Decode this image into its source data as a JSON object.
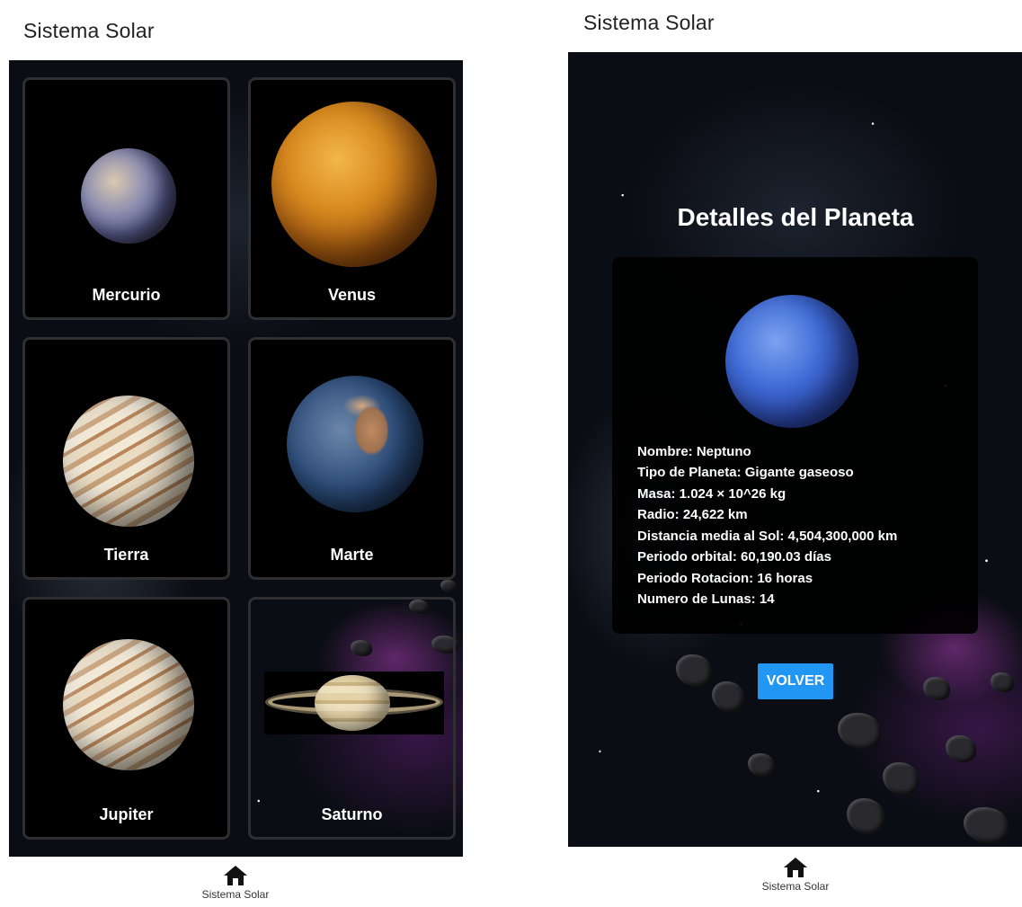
{
  "left_screen": {
    "app_title": "Sistema Solar",
    "planets": [
      {
        "name": "Mercurio"
      },
      {
        "name": "Venus"
      },
      {
        "name": "Tierra"
      },
      {
        "name": "Marte"
      },
      {
        "name": "Jupiter"
      },
      {
        "name": "Saturno"
      }
    ],
    "nav": {
      "label": "Sistema Solar",
      "icon": "home-icon"
    }
  },
  "right_screen": {
    "app_title": "Sistema Solar",
    "heading": "Detalles del Planeta",
    "details": {
      "name": "Nombre: Neptuno",
      "type": "Tipo de Planeta: Gigante gaseoso",
      "mass": "Masa: 1.024 × 10^26 kg",
      "radius": "Radio: 24,622 km",
      "distance": "Distancia media al Sol: 4,504,300,000 km",
      "orbit": "Periodo orbital: 60,190.03 días",
      "rotation": "Periodo Rotacion: 16 horas",
      "moons": "Numero de Lunas: 14"
    },
    "button_label": "VOLVER",
    "nav": {
      "label": "Sistema Solar",
      "icon": "home-icon"
    }
  },
  "colors": {
    "accent": "#2196f3",
    "card_bg": "#000000",
    "card_border": "#2e2e33"
  }
}
